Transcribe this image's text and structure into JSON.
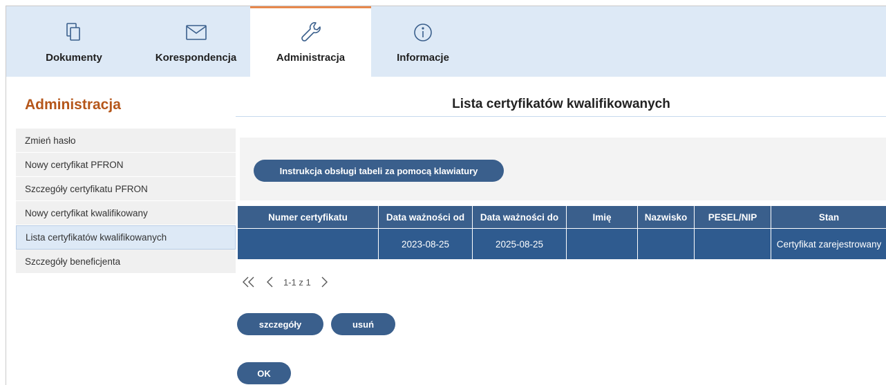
{
  "nav": {
    "tabs": [
      {
        "label": "Dokumenty",
        "icon": "documents-icon"
      },
      {
        "label": "Korespondencja",
        "icon": "envelope-icon"
      },
      {
        "label": "Administracja",
        "icon": "wrench-icon",
        "active": true
      },
      {
        "label": "Informacje",
        "icon": "info-icon"
      }
    ]
  },
  "sidebar": {
    "title": "Administracja",
    "items": [
      {
        "label": "Zmień hasło"
      },
      {
        "label": "Nowy certyfikat PFRON"
      },
      {
        "label": "Szczegóły certyfikatu PFRON"
      },
      {
        "label": "Nowy certyfikat kwalifikowany"
      },
      {
        "label": "Lista certyfikatów kwalifikowanych",
        "selected": true
      },
      {
        "label": "Szczegóły beneficjenta"
      }
    ]
  },
  "main": {
    "title": "Lista certyfikatów kwalifikowanych",
    "keyboard_help_label": "Instrukcja obsługi tabeli za pomocą klawiatury",
    "table": {
      "columns": [
        "Numer certyfikatu",
        "Data ważności od",
        "Data ważności do",
        "Imię",
        "Nazwisko",
        "PESEL/NIP",
        "Stan"
      ],
      "rows": [
        [
          "",
          "2023-08-25",
          "2025-08-25",
          "",
          "",
          "",
          "Certyfikat zarejestrowany"
        ]
      ]
    },
    "pagination": {
      "info": "1-1 z 1"
    },
    "actions": {
      "details_label": "szczegóły",
      "delete_label": "usuń",
      "ok_label": "OK"
    }
  },
  "colors": {
    "accent_orange": "#b5561a",
    "tab_highlight": "#e7884d",
    "nav_background": "#dde9f6",
    "primary_button": "#3a5f8c",
    "table_row": "#2f5b8f"
  }
}
